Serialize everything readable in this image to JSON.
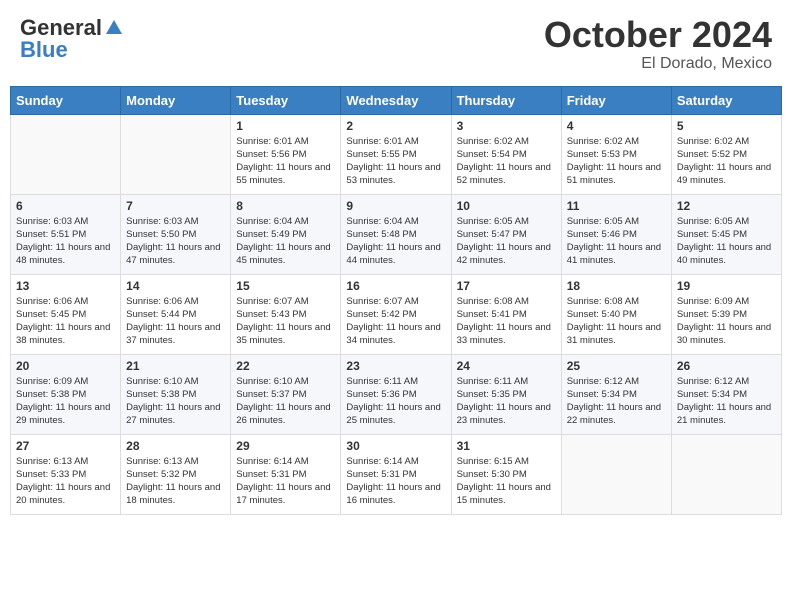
{
  "header": {
    "logo_general": "General",
    "logo_blue": "Blue",
    "month_title": "October 2024",
    "location": "El Dorado, Mexico"
  },
  "weekdays": [
    "Sunday",
    "Monday",
    "Tuesday",
    "Wednesday",
    "Thursday",
    "Friday",
    "Saturday"
  ],
  "weeks": [
    [
      {
        "day": "",
        "sunrise": "",
        "sunset": "",
        "daylight": ""
      },
      {
        "day": "",
        "sunrise": "",
        "sunset": "",
        "daylight": ""
      },
      {
        "day": "1",
        "sunrise": "Sunrise: 6:01 AM",
        "sunset": "Sunset: 5:56 PM",
        "daylight": "Daylight: 11 hours and 55 minutes."
      },
      {
        "day": "2",
        "sunrise": "Sunrise: 6:01 AM",
        "sunset": "Sunset: 5:55 PM",
        "daylight": "Daylight: 11 hours and 53 minutes."
      },
      {
        "day": "3",
        "sunrise": "Sunrise: 6:02 AM",
        "sunset": "Sunset: 5:54 PM",
        "daylight": "Daylight: 11 hours and 52 minutes."
      },
      {
        "day": "4",
        "sunrise": "Sunrise: 6:02 AM",
        "sunset": "Sunset: 5:53 PM",
        "daylight": "Daylight: 11 hours and 51 minutes."
      },
      {
        "day": "5",
        "sunrise": "Sunrise: 6:02 AM",
        "sunset": "Sunset: 5:52 PM",
        "daylight": "Daylight: 11 hours and 49 minutes."
      }
    ],
    [
      {
        "day": "6",
        "sunrise": "Sunrise: 6:03 AM",
        "sunset": "Sunset: 5:51 PM",
        "daylight": "Daylight: 11 hours and 48 minutes."
      },
      {
        "day": "7",
        "sunrise": "Sunrise: 6:03 AM",
        "sunset": "Sunset: 5:50 PM",
        "daylight": "Daylight: 11 hours and 47 minutes."
      },
      {
        "day": "8",
        "sunrise": "Sunrise: 6:04 AM",
        "sunset": "Sunset: 5:49 PM",
        "daylight": "Daylight: 11 hours and 45 minutes."
      },
      {
        "day": "9",
        "sunrise": "Sunrise: 6:04 AM",
        "sunset": "Sunset: 5:48 PM",
        "daylight": "Daylight: 11 hours and 44 minutes."
      },
      {
        "day": "10",
        "sunrise": "Sunrise: 6:05 AM",
        "sunset": "Sunset: 5:47 PM",
        "daylight": "Daylight: 11 hours and 42 minutes."
      },
      {
        "day": "11",
        "sunrise": "Sunrise: 6:05 AM",
        "sunset": "Sunset: 5:46 PM",
        "daylight": "Daylight: 11 hours and 41 minutes."
      },
      {
        "day": "12",
        "sunrise": "Sunrise: 6:05 AM",
        "sunset": "Sunset: 5:45 PM",
        "daylight": "Daylight: 11 hours and 40 minutes."
      }
    ],
    [
      {
        "day": "13",
        "sunrise": "Sunrise: 6:06 AM",
        "sunset": "Sunset: 5:45 PM",
        "daylight": "Daylight: 11 hours and 38 minutes."
      },
      {
        "day": "14",
        "sunrise": "Sunrise: 6:06 AM",
        "sunset": "Sunset: 5:44 PM",
        "daylight": "Daylight: 11 hours and 37 minutes."
      },
      {
        "day": "15",
        "sunrise": "Sunrise: 6:07 AM",
        "sunset": "Sunset: 5:43 PM",
        "daylight": "Daylight: 11 hours and 35 minutes."
      },
      {
        "day": "16",
        "sunrise": "Sunrise: 6:07 AM",
        "sunset": "Sunset: 5:42 PM",
        "daylight": "Daylight: 11 hours and 34 minutes."
      },
      {
        "day": "17",
        "sunrise": "Sunrise: 6:08 AM",
        "sunset": "Sunset: 5:41 PM",
        "daylight": "Daylight: 11 hours and 33 minutes."
      },
      {
        "day": "18",
        "sunrise": "Sunrise: 6:08 AM",
        "sunset": "Sunset: 5:40 PM",
        "daylight": "Daylight: 11 hours and 31 minutes."
      },
      {
        "day": "19",
        "sunrise": "Sunrise: 6:09 AM",
        "sunset": "Sunset: 5:39 PM",
        "daylight": "Daylight: 11 hours and 30 minutes."
      }
    ],
    [
      {
        "day": "20",
        "sunrise": "Sunrise: 6:09 AM",
        "sunset": "Sunset: 5:38 PM",
        "daylight": "Daylight: 11 hours and 29 minutes."
      },
      {
        "day": "21",
        "sunrise": "Sunrise: 6:10 AM",
        "sunset": "Sunset: 5:38 PM",
        "daylight": "Daylight: 11 hours and 27 minutes."
      },
      {
        "day": "22",
        "sunrise": "Sunrise: 6:10 AM",
        "sunset": "Sunset: 5:37 PM",
        "daylight": "Daylight: 11 hours and 26 minutes."
      },
      {
        "day": "23",
        "sunrise": "Sunrise: 6:11 AM",
        "sunset": "Sunset: 5:36 PM",
        "daylight": "Daylight: 11 hours and 25 minutes."
      },
      {
        "day": "24",
        "sunrise": "Sunrise: 6:11 AM",
        "sunset": "Sunset: 5:35 PM",
        "daylight": "Daylight: 11 hours and 23 minutes."
      },
      {
        "day": "25",
        "sunrise": "Sunrise: 6:12 AM",
        "sunset": "Sunset: 5:34 PM",
        "daylight": "Daylight: 11 hours and 22 minutes."
      },
      {
        "day": "26",
        "sunrise": "Sunrise: 6:12 AM",
        "sunset": "Sunset: 5:34 PM",
        "daylight": "Daylight: 11 hours and 21 minutes."
      }
    ],
    [
      {
        "day": "27",
        "sunrise": "Sunrise: 6:13 AM",
        "sunset": "Sunset: 5:33 PM",
        "daylight": "Daylight: 11 hours and 20 minutes."
      },
      {
        "day": "28",
        "sunrise": "Sunrise: 6:13 AM",
        "sunset": "Sunset: 5:32 PM",
        "daylight": "Daylight: 11 hours and 18 minutes."
      },
      {
        "day": "29",
        "sunrise": "Sunrise: 6:14 AM",
        "sunset": "Sunset: 5:31 PM",
        "daylight": "Daylight: 11 hours and 17 minutes."
      },
      {
        "day": "30",
        "sunrise": "Sunrise: 6:14 AM",
        "sunset": "Sunset: 5:31 PM",
        "daylight": "Daylight: 11 hours and 16 minutes."
      },
      {
        "day": "31",
        "sunrise": "Sunrise: 6:15 AM",
        "sunset": "Sunset: 5:30 PM",
        "daylight": "Daylight: 11 hours and 15 minutes."
      },
      {
        "day": "",
        "sunrise": "",
        "sunset": "",
        "daylight": ""
      },
      {
        "day": "",
        "sunrise": "",
        "sunset": "",
        "daylight": ""
      }
    ]
  ]
}
